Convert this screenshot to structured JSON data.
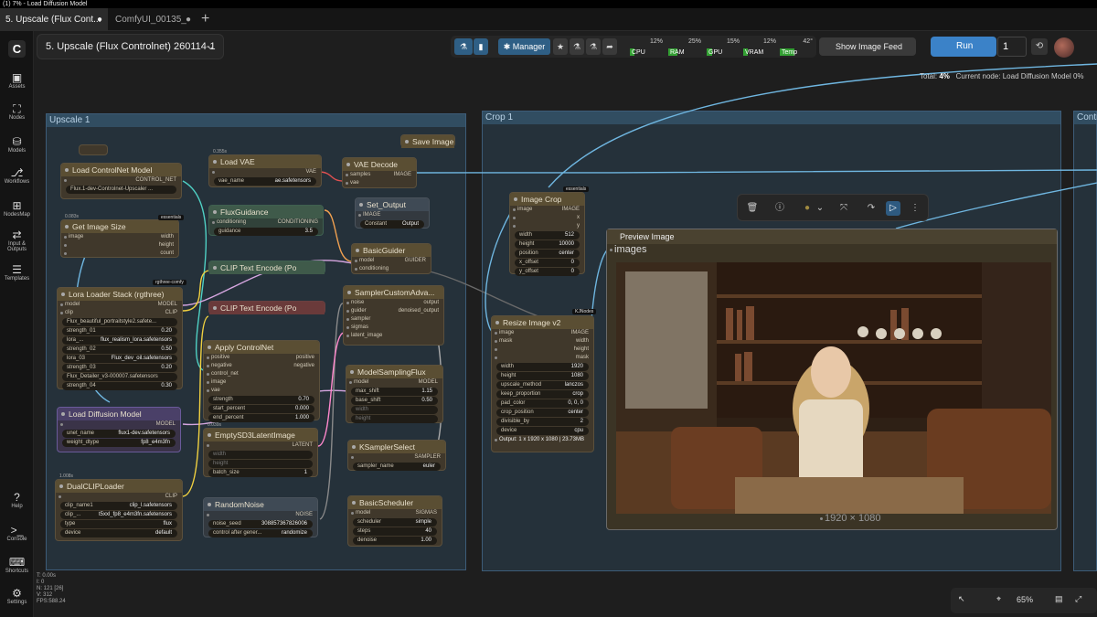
{
  "window": {
    "title": "(1) 7% - Load Diffusion Model"
  },
  "tabs": [
    {
      "label": "5. Upscale (Flux Cont...",
      "modified": "●"
    },
    {
      "label": "ComfyUI_00135_",
      "modified": "●"
    }
  ],
  "add_tab": "+",
  "sidebar": {
    "logo": "C",
    "items": [
      {
        "label": "Assets",
        "icon": "▣"
      },
      {
        "label": "Nodes",
        "icon": "⛶"
      },
      {
        "label": "Models",
        "icon": "⛁"
      },
      {
        "label": "Workflows",
        "icon": "⎇"
      },
      {
        "label": "NodesMap",
        "icon": "⊞"
      },
      {
        "label": "Input & Outputs",
        "icon": "⇄"
      },
      {
        "label": "Templates",
        "icon": "☰"
      },
      {
        "label": "Help",
        "icon": "?"
      },
      {
        "label": "Console",
        "icon": ">_"
      },
      {
        "label": "Shortcuts",
        "icon": "⌨"
      },
      {
        "label": "Settings",
        "icon": "⚙"
      }
    ]
  },
  "workflow_selector": {
    "label": "5. Upscale (Flux Controlnet) 260114-1",
    "chevron": "⌄"
  },
  "toolbar": {
    "manager_label": "Manager",
    "meters": [
      {
        "label": "CPU",
        "value": "12%",
        "level": 0.12
      },
      {
        "label": "RAM",
        "value": "25%",
        "level": 0.25
      },
      {
        "label": "GPU",
        "value": "15%",
        "level": 0.15
      },
      {
        "label": "VRAM",
        "value": "12%",
        "level": 0.12
      },
      {
        "label": "Temp",
        "value": "42°",
        "level": 0.42
      }
    ],
    "image_feed_label": "Show Image Feed",
    "run_label": "Run",
    "run_count": "1"
  },
  "progress": {
    "total_label": "Total:",
    "total_value": "4%",
    "current_label": "Current node: Load Diffusion Model 0%"
  },
  "groups": [
    {
      "title": "Upscale 1"
    },
    {
      "title": "Crop 1"
    },
    {
      "title": "Contr"
    }
  ],
  "nodes": {
    "load_controlnet": {
      "title": "Load ControlNet Model",
      "output": "CONTROL_NET",
      "widget": "Flux.1-dev-Controlnet-Upscaler ..."
    },
    "get_image_size": {
      "title": "Get Image Size",
      "badge": "essentials",
      "time": "0.083s",
      "input": "image",
      "outputs": [
        "width",
        "height",
        "count"
      ]
    },
    "lora_stack": {
      "title": "Lora Loader Stack (rgthree)",
      "badge": "rgthree-comfy",
      "inputs": [
        "model",
        "clip"
      ],
      "outputs": [
        "MODEL",
        "CLIP"
      ],
      "widgets": [
        {
          "name": "Flux_beautiful_portraitstyle2.safete...",
          "value": ""
        },
        {
          "name": "strength_01",
          "value": "0.20"
        },
        {
          "name": "lora_...",
          "value": "flux_realism_lora.safetensors"
        },
        {
          "name": "strength_02",
          "value": "0.50"
        },
        {
          "name": "lora_03",
          "value": "Flux_dev_oil.safetensors"
        },
        {
          "name": "strength_03",
          "value": "0.20"
        },
        {
          "name": "Flux_Detailer_v3-000007.safetensors",
          "value": ""
        },
        {
          "name": "strength_04",
          "value": "0.30"
        }
      ]
    },
    "load_diffusion": {
      "title": "Load Diffusion Model",
      "output": "MODEL",
      "widgets": [
        {
          "name": "unet_name",
          "value": "flux1-dev.safetensors"
        },
        {
          "name": "weight_dtype",
          "value": "fp8_e4m3fn"
        }
      ]
    },
    "dual_clip": {
      "title": "DualCLIPLoader",
      "time": "1.008s",
      "output": "CLIP",
      "widgets": [
        {
          "name": "clip_name1",
          "value": "clip_l.safetensors"
        },
        {
          "name": "clip_...",
          "value": "t5xxl_fp8_e4m3fn.safetensors"
        },
        {
          "name": "type",
          "value": "flux"
        },
        {
          "name": "device",
          "value": "default"
        }
      ]
    },
    "load_vae": {
      "title": "Load VAE",
      "time": "0.355s",
      "output": "VAE",
      "widget_name": "vae_name",
      "widget_value": "ae.safetensors"
    },
    "flux_guidance": {
      "title": "FluxGuidance",
      "input": "conditioning",
      "output": "CONDITIONING",
      "widget_name": "guidance",
      "widget_value": "3.5"
    },
    "clip_text_1": {
      "title": "CLIP Text Encode (Po"
    },
    "clip_text_2": {
      "title": "CLIP Text Encode (Po"
    },
    "apply_controlnet": {
      "title": "Apply ControlNet",
      "inputs": [
        "positive",
        "negative",
        "control_net",
        "image",
        "vae"
      ],
      "outputs": [
        "positive",
        "negative"
      ],
      "widgets": [
        {
          "name": "strength",
          "value": "0.70"
        },
        {
          "name": "start_percent",
          "value": "0.000"
        },
        {
          "name": "end_percent",
          "value": "1.000"
        }
      ]
    },
    "empty_latent": {
      "title": "EmptySD3LatentImage",
      "time": "0.039s",
      "output": "LATENT",
      "widgets": [
        "width",
        "height"
      ],
      "batch_name": "batch_size",
      "batch_value": "1"
    },
    "random_noise": {
      "title": "RandomNoise",
      "output": "NOISE",
      "widgets": [
        {
          "name": "noise_seed",
          "value": "308857367826006"
        },
        {
          "name": "control after gener...",
          "value": "randomize"
        }
      ]
    },
    "vae_decode": {
      "title": "VAE Decode",
      "inputs": [
        "samples",
        "vae"
      ],
      "output": "IMAGE"
    },
    "save_image": {
      "title": "Save Image"
    },
    "set_output": {
      "title": "Set_Output",
      "input": "IMAGE",
      "widget_name": "Constant",
      "widget_value": "Output"
    },
    "basic_guider": {
      "title": "BasicGuider",
      "inputs": [
        "model",
        "conditioning"
      ],
      "output": "GUIDER"
    },
    "sampler_custom": {
      "title": "SamplerCustomAdva...",
      "inputs": [
        "noise",
        "guider",
        "sampler",
        "sigmas",
        "latent_image"
      ],
      "outputs": [
        "output",
        "denoised_output"
      ]
    },
    "model_sampling": {
      "title": "ModelSamplingFlux",
      "input": "model",
      "output": "MODEL",
      "widgets": [
        {
          "name": "max_shift",
          "value": "1.15"
        },
        {
          "name": "base_shift",
          "value": "0.50"
        },
        {
          "name": "width",
          "value": ""
        },
        {
          "name": "height",
          "value": ""
        }
      ]
    },
    "ksampler_select": {
      "title": "KSamplerSelect",
      "output": "SAMPLER",
      "widget_name": "sampler_name",
      "widget_value": "euler"
    },
    "basic_scheduler": {
      "title": "BasicScheduler",
      "input": "model",
      "output": "SIGMAS",
      "widgets": [
        {
          "name": "scheduler",
          "value": "simple"
        },
        {
          "name": "steps",
          "value": "40"
        },
        {
          "name": "denoise",
          "value": "1.00"
        }
      ]
    },
    "image_crop": {
      "title": "Image Crop",
      "badge": "essentials",
      "input": "image",
      "outputs": [
        "IMAGE",
        "x",
        "y"
      ],
      "widgets": [
        {
          "name": "width",
          "value": "512"
        },
        {
          "name": "height",
          "value": "10000"
        },
        {
          "name": "position",
          "value": "center"
        },
        {
          "name": "x_offset",
          "value": "0"
        },
        {
          "name": "y_offset",
          "value": "0"
        }
      ]
    },
    "resize_image": {
      "title": "Resize Image v2",
      "badge": "KJNodes",
      "inputs": [
        "image",
        "mask"
      ],
      "outputs": [
        "IMAGE",
        "width",
        "height",
        "mask"
      ],
      "widgets": [
        {
          "name": "width",
          "value": "1920"
        },
        {
          "name": "height",
          "value": "1080"
        },
        {
          "name": "upscale_method",
          "value": "lanczos"
        },
        {
          "name": "keep_proportion",
          "value": "crop"
        },
        {
          "name": "pad_color",
          "value": "0, 0, 0"
        },
        {
          "name": "crop_position",
          "value": "center"
        },
        {
          "name": "divisible_by",
          "value": "2"
        },
        {
          "name": "device",
          "value": "cpu"
        }
      ],
      "output_text": "Output: 1 x 1920 x 1080 | 23.73MB"
    },
    "preview_image": {
      "title": "Preview Image",
      "input": "images",
      "caption": "1920 × 1080"
    }
  },
  "bottom_tools": {
    "zoom": "65%"
  },
  "stats": {
    "t": "T: 0.00s",
    "i": "I: 0",
    "n": "N: 121 [26]",
    "v": "V: 312",
    "fps": "FPS:588.24"
  }
}
